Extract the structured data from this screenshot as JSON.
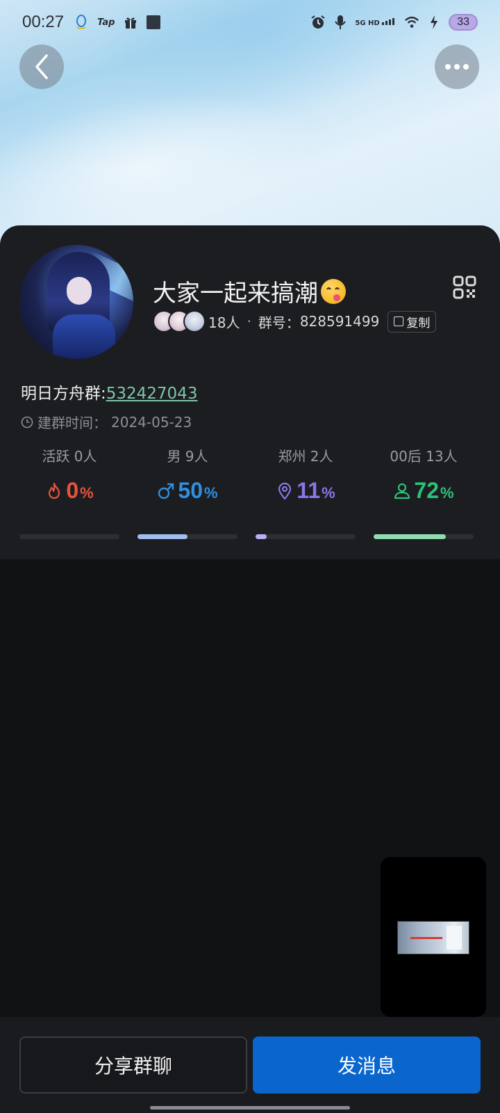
{
  "status_bar": {
    "time": "00:27",
    "tap_label": "Tap",
    "network": "5G HD",
    "battery": "33"
  },
  "group": {
    "title": "大家一起来搞潮",
    "member_count": "18人",
    "separator": "·",
    "id_label": "群号：",
    "id_value": "828591499",
    "copy_label": "复制",
    "desc_prefix": "明日方舟群:",
    "desc_link": "532427043",
    "created_label": "建群时间：",
    "created_value": "2024-05-23"
  },
  "stats": [
    {
      "label": "活跃 0人",
      "value": "0",
      "unit": "%",
      "icon": "flame-icon",
      "color": "#e8533c",
      "fill": 0.0,
      "bar_color": "#e8533c"
    },
    {
      "label": "男 9人",
      "value": "50",
      "unit": "%",
      "icon": "male-icon",
      "color": "#2f8fe0",
      "fill": 0.5,
      "bar_color": "#9fbdf0"
    },
    {
      "label": "郑州 2人",
      "value": "11",
      "unit": "%",
      "icon": "location-pin-icon",
      "color": "#8a76e8",
      "fill": 0.11,
      "bar_color": "#b8aef2"
    },
    {
      "label": "00后 13人",
      "value": "72",
      "unit": "%",
      "icon": "person-icon",
      "color": "#2cc27a",
      "fill": 0.72,
      "bar_color": "#8fdcb0"
    }
  ],
  "actions": {
    "share_label": "分享群聊",
    "send_label": "发消息"
  },
  "colors": {
    "primary": "#0a66cc",
    "card_bg": "#1c1d20",
    "page_bg": "#111214"
  }
}
